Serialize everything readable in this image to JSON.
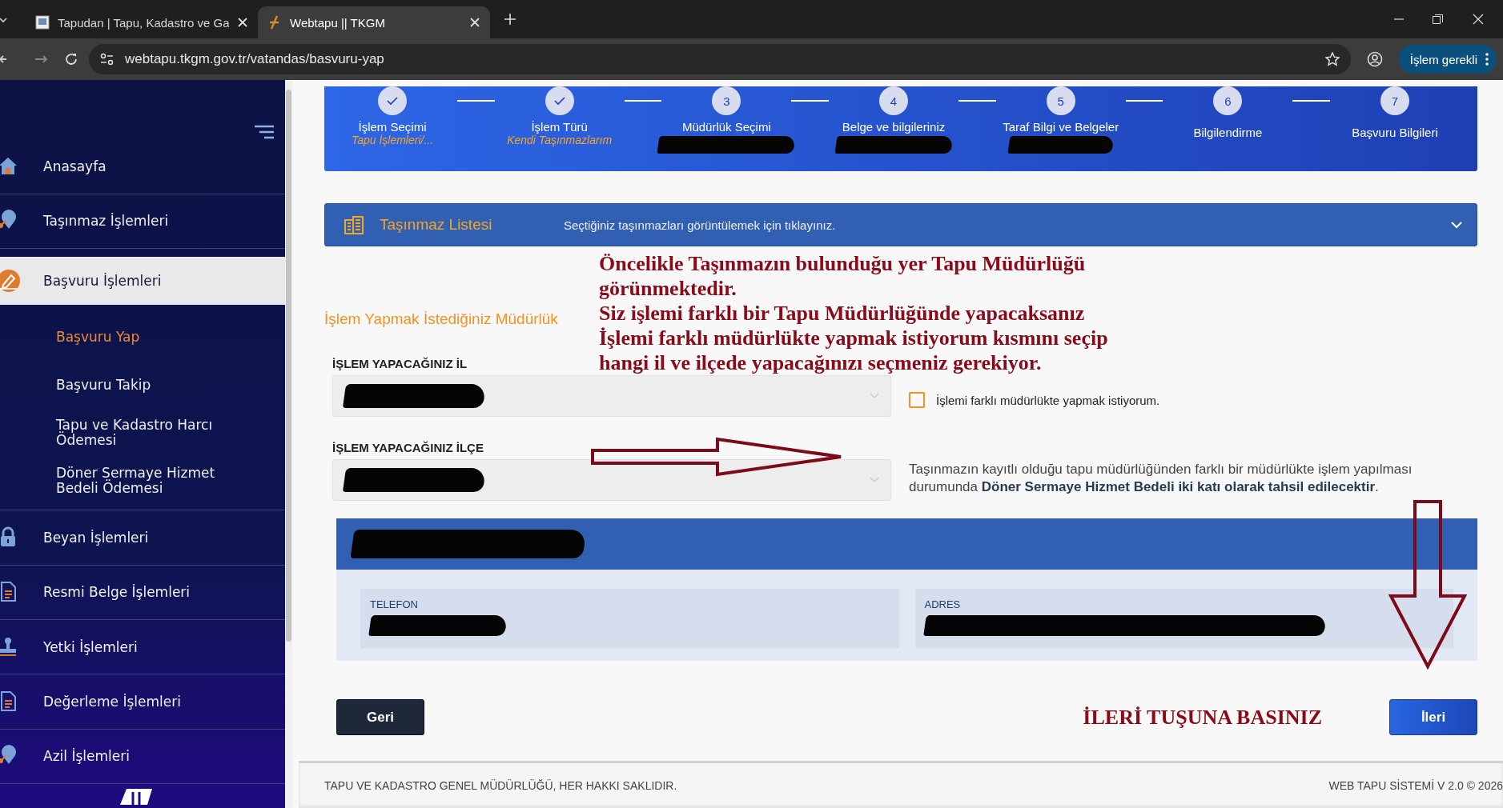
{
  "browser": {
    "tabs": [
      {
        "title": "Tapudan | Tapu, Kadastro ve Ga",
        "selected": false
      },
      {
        "title": "Webtapu || TKGM",
        "selected": true
      }
    ],
    "url": "webtapu.tkgm.gov.tr/vatandas/basvuru-yap",
    "profile_button": "İşlem gerekli"
  },
  "sidebar": {
    "items": [
      {
        "label": "Anasayfa",
        "kind": "home",
        "selected": false
      },
      {
        "label": "Taşınmaz İşlemleri",
        "kind": "pin",
        "selected": false
      },
      {
        "label": "Başvuru İşlemleri",
        "kind": "pen",
        "selected": true,
        "expanded": true,
        "children": [
          {
            "label": "Başvuru Yap",
            "selected": true
          },
          {
            "label": "Başvuru Takip",
            "selected": false
          },
          {
            "label": "Tapu ve Kadastro Harcı Ödemesi",
            "selected": false
          },
          {
            "label": "Döner Sermaye Hizmet Bedeli Ödemesi",
            "selected": false
          }
        ]
      },
      {
        "label": "Beyan İşlemleri",
        "kind": "lock",
        "selected": false
      },
      {
        "label": "Resmi Belge İşlemleri",
        "kind": "document",
        "selected": false
      },
      {
        "label": "Yetki İşlemleri",
        "kind": "stamp",
        "selected": false
      },
      {
        "label": "Değerleme İşlemleri",
        "kind": "document",
        "selected": false
      },
      {
        "label": "Azil İşlemleri",
        "kind": "pin",
        "selected": false
      }
    ]
  },
  "steps": [
    {
      "title": "İşlem Seçimi",
      "subtitle": "Tapu İşlemleri/...",
      "done": true
    },
    {
      "title": "İşlem Türü",
      "subtitle": "Kendi Taşınmazlarım",
      "done": true
    },
    {
      "number": "3",
      "title": "Müdürlük Seçimi",
      "subtitle_redacted": true,
      "done": false
    },
    {
      "number": "4",
      "title": "Belge ve bilgileriniz",
      "subtitle_redacted": true,
      "done": false
    },
    {
      "number": "5",
      "title": "Taraf Bilgi ve Belgeler",
      "subtitle_redacted": true,
      "done": false
    },
    {
      "number": "6",
      "title": "Bilgilendirme",
      "done": false
    },
    {
      "number": "7",
      "title": "Başvuru Bilgileri",
      "done": false
    }
  ],
  "property_list": {
    "title": "Taşınmaz Listesi",
    "hint": "Seçtiğiniz taşınmazları görüntülemek için tıklayınız.",
    "expanded": false
  },
  "section_title": "İşlem Yapmak İstediğiniz Müdürlük",
  "fields": [
    {
      "label": "İŞLEM YAPACAĞINIZ İL",
      "redacted": true
    },
    {
      "label": "İŞLEM YAPACAĞINIZ İLÇE",
      "redacted": true
    }
  ],
  "checkbox": {
    "label": "İşlemi farklı müdürlükte yapmak istiyorum.",
    "checked": false
  },
  "notice": "Taşınmazın kayıtlı olduğu tapu müdürlüğünden farklı bir müdürlükte işlem yapılması durumunda **Döner Sermaye Hizmet Bedeli iki katı olarak tahsil edilecektir**.",
  "office_card": {
    "title_redacted": true,
    "fields": [
      {
        "label": "TELEFON",
        "redacted": true
      },
      {
        "label": "ADRES",
        "redacted": true
      }
    ]
  },
  "annotations": {
    "instruction_lines": [
      "Öncelikle Taşınmazın bulunduğu yer Tapu Müdürlüğü",
      "görünmektedir.",
      "Siz işlemi farklı bir Tapu Müdürlüğünde yapacaksanız",
      "İşlemi farklı müdürlükte yapmak istiyorum kısmını seçip",
      "hangi il ve ilçede yapacağınızı seçmeniz gerekiyor."
    ],
    "next_hint": "İLERİ TUŞUNA BASINIZ"
  },
  "buttons": {
    "back": "Geri",
    "next": "İleri"
  },
  "footer": {
    "left": "TAPU VE KADASTRO GENEL MÜDÜRLÜĞÜ, HER HAKKI SAKLIDIR.",
    "right": "WEB TAPU SİSTEMİ V 2.0 © 2026"
  }
}
